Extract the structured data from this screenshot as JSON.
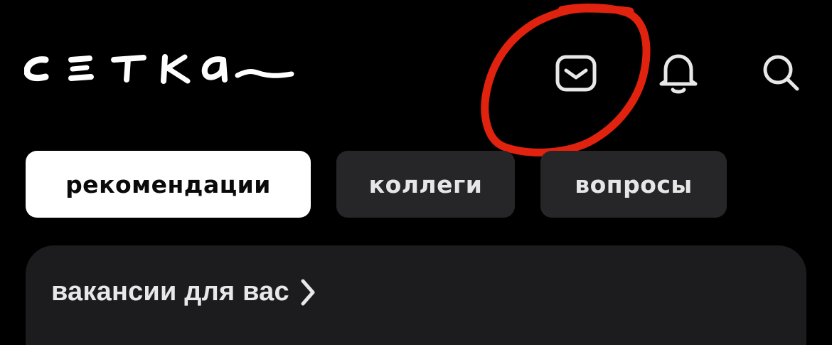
{
  "header": {
    "logo_text": "сетка",
    "icons": {
      "messages": "envelope-icon",
      "notifications": "bell-icon",
      "search": "search-icon"
    },
    "annotation_color": "#e0220f"
  },
  "tabs": [
    {
      "label": "рекомендации",
      "active": true
    },
    {
      "label": "коллеги",
      "active": false
    },
    {
      "label": "вопросы",
      "active": false
    }
  ],
  "feed": {
    "section_title": "вакансии для вас"
  },
  "colors": {
    "background": "#000000",
    "tab_active_bg": "#ffffff",
    "tab_inactive_bg": "#262628",
    "card_bg": "#1c1c1e",
    "annotation": "#e0220f"
  }
}
